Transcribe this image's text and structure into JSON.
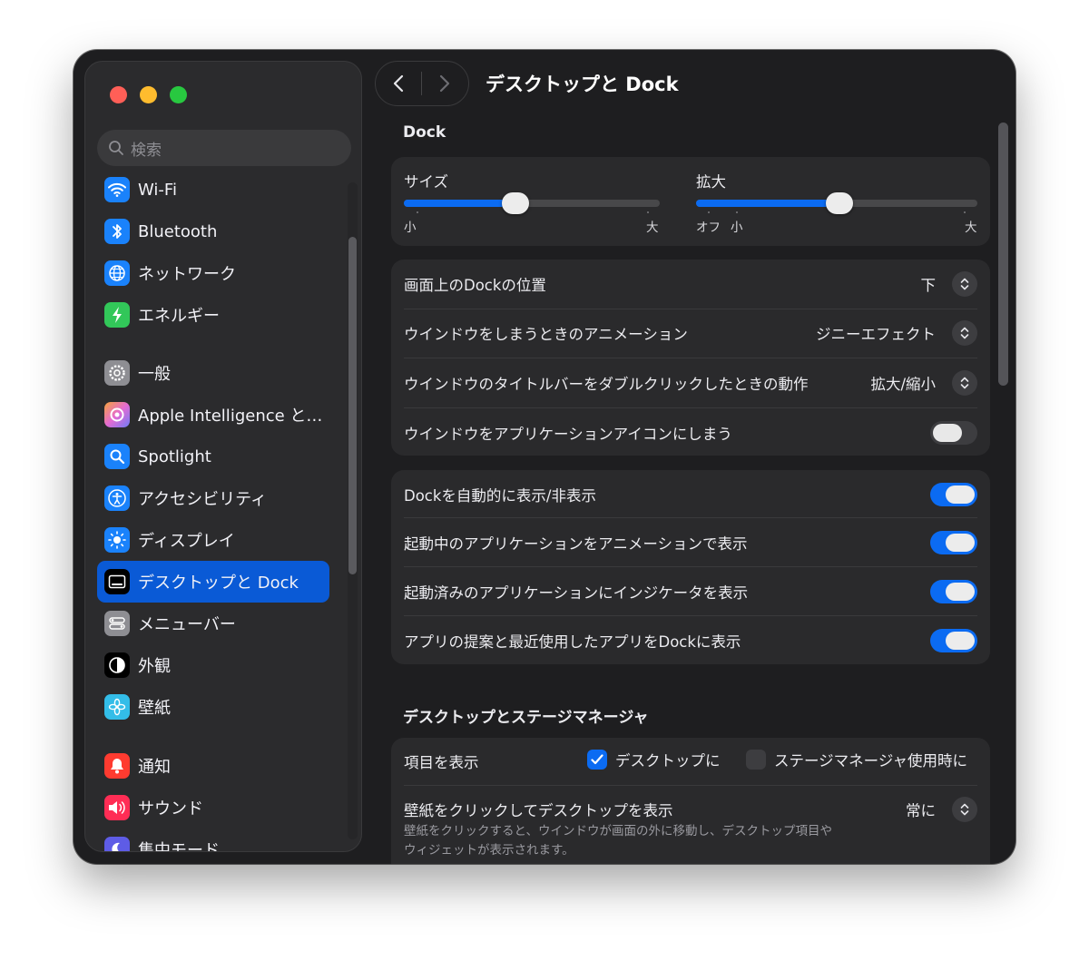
{
  "window": {
    "title": "デスクトップと Dock"
  },
  "search": {
    "placeholder": "検索"
  },
  "sidebar": {
    "items": [
      {
        "label": "Wi-Fi",
        "icon": "wifi-icon",
        "color": "#1a82fb"
      },
      {
        "label": "Bluetooth",
        "icon": "bluetooth-icon",
        "color": "#1a82fb"
      },
      {
        "label": "ネットワーク",
        "icon": "globe-icon",
        "color": "#1a82fb"
      },
      {
        "label": "エネルギー",
        "icon": "battery-bolt-icon",
        "color": "#32c759"
      },
      {
        "label": "一般",
        "icon": "gear-icon",
        "color": "#8e8e93"
      },
      {
        "label": "Apple Intelligence と…",
        "icon": "apple-intelligence-icon",
        "color": "#e46bd2"
      },
      {
        "label": "Spotlight",
        "icon": "spotlight-icon",
        "color": "#1a82fb"
      },
      {
        "label": "アクセシビリティ",
        "icon": "accessibility-icon",
        "color": "#1a82fb"
      },
      {
        "label": "ディスプレイ",
        "icon": "display-sun-icon",
        "color": "#1a82fb"
      },
      {
        "label": "デスクトップと Dock",
        "icon": "dock-icon",
        "color": "#000000",
        "selected": true
      },
      {
        "label": "メニューバー",
        "icon": "menubar-icon",
        "color": "#8e8e93"
      },
      {
        "label": "外観",
        "icon": "appearance-icon",
        "color": "#000000"
      },
      {
        "label": "壁紙",
        "icon": "wallpaper-icon",
        "color": "#33bde8"
      },
      {
        "label": "通知",
        "icon": "bell-icon",
        "color": "#ff3b30"
      },
      {
        "label": "サウンド",
        "icon": "speaker-icon",
        "color": "#ff2d55"
      },
      {
        "label": "集中モード",
        "icon": "moon-icon",
        "color": "#5e5ce6"
      }
    ]
  },
  "dock": {
    "section_title": "Dock",
    "size": {
      "label": "サイズ",
      "min_label": "小",
      "max_label": "大",
      "value": 0.43
    },
    "magnify": {
      "label": "拡大",
      "off_label": "オフ",
      "min_label": "小",
      "max_label": "大",
      "value": 0.51
    },
    "rows1": [
      {
        "label": "画面上のDockの位置",
        "value": "下"
      },
      {
        "label": "ウインドウをしまうときのアニメーション",
        "value": "ジニーエフェクト"
      },
      {
        "label": "ウインドウのタイトルバーをダブルクリックしたときの動作",
        "value": "拡大/縮小"
      },
      {
        "label": "ウインドウをアプリケーションアイコンにしまう",
        "toggle": false
      }
    ],
    "rows2": [
      {
        "label": "Dockを自動的に表示/非表示",
        "toggle": true
      },
      {
        "label": "起動中のアプリケーションをアニメーションで表示",
        "toggle": true
      },
      {
        "label": "起動済みのアプリケーションにインジケータを表示",
        "toggle": true
      },
      {
        "label": "アプリの提案と最近使用したアプリをDockに表示",
        "toggle": true
      }
    ]
  },
  "desktop": {
    "section_title": "デスクトップとステージマネージャ",
    "show_items": {
      "label": "項目を表示",
      "option1": "デスクトップに",
      "option1_checked": true,
      "option2": "ステージマネージャ使用時に",
      "option2_checked": false
    },
    "click_wallpaper": {
      "label": "壁紙をクリックしてデスクトップを表示",
      "value": "常に",
      "description_line1": "壁紙をクリックすると、ウインドウが画面の外に移動し、デスクトップ項目や",
      "description_line2": "ウィジェットが表示されます。"
    }
  },
  "colors": {
    "accent": "#0b6bf2",
    "selection": "#0a5ad6"
  }
}
